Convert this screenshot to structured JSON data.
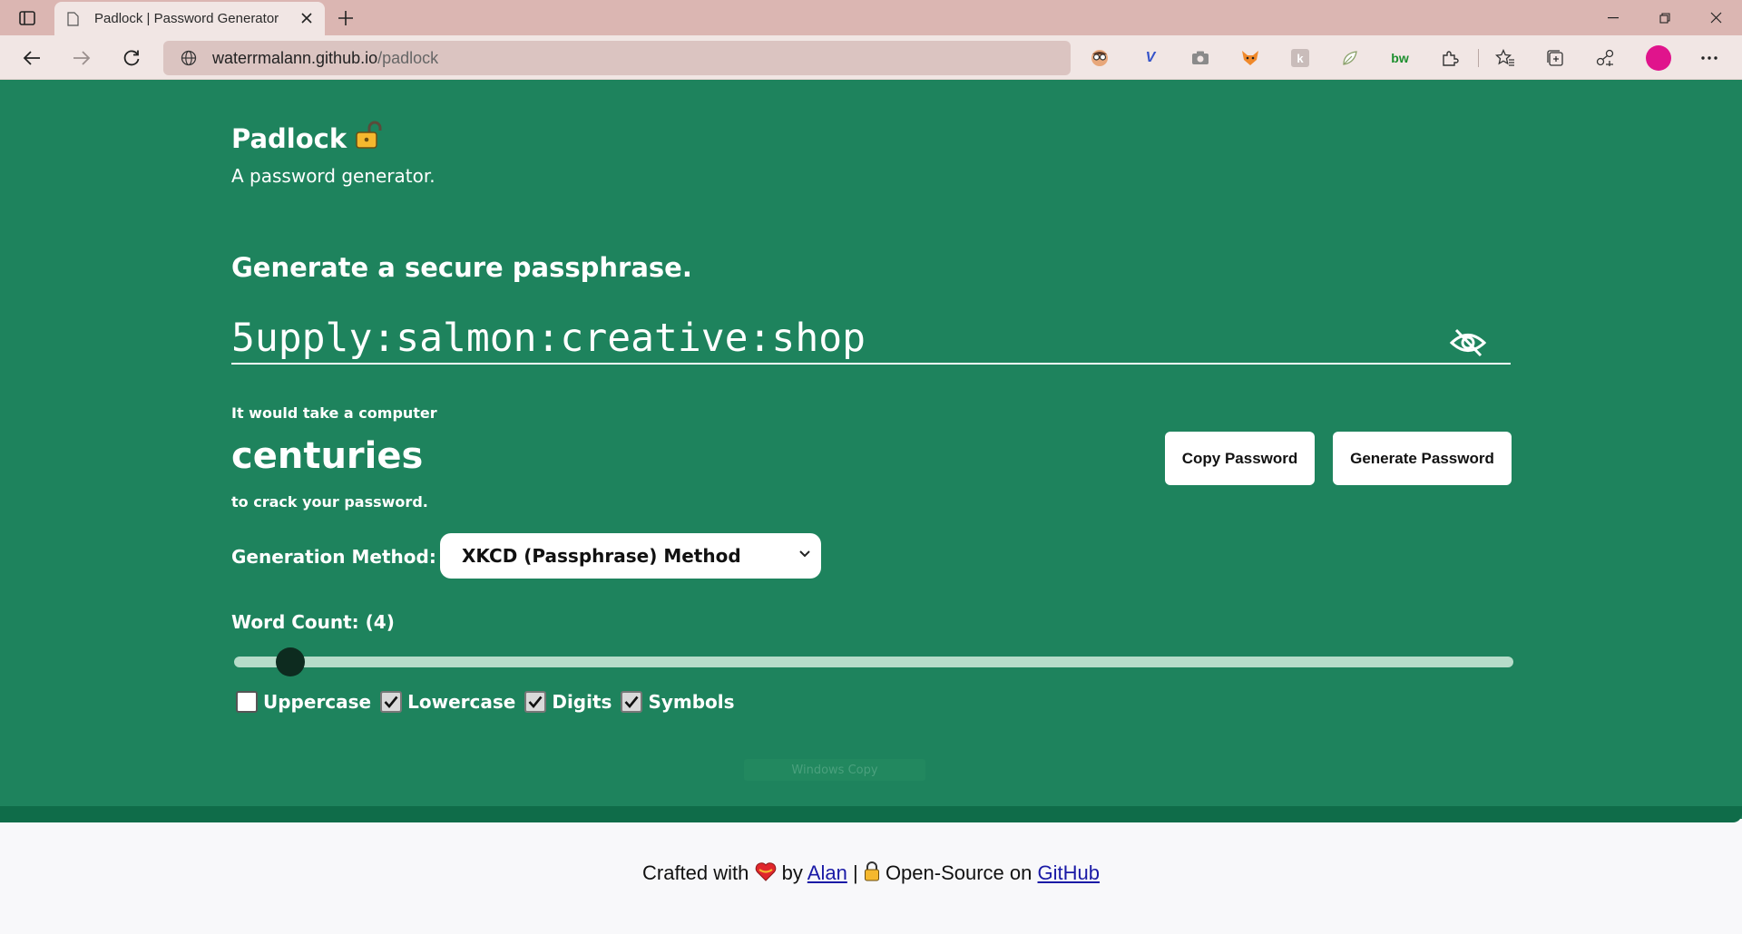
{
  "browser": {
    "tab": {
      "title": "Padlock | Password Generator"
    },
    "url": {
      "host": "waterrmalann.github.io",
      "path": "/padlock"
    },
    "extensions": [
      "face-extension",
      "v-extension",
      "camera-extension",
      "fox-extension",
      "k-extension",
      "leaf-extension",
      "bw-extension",
      "puzzle-extension"
    ],
    "ext_bw_label": "bw",
    "ext_v_label": "V",
    "ext_k_label": "k",
    "accent": "#e0148c"
  },
  "app": {
    "title": "Padlock",
    "subtitle": "A password generator.",
    "heading": "Generate a secure passphrase.",
    "password": "5upply:salmon:creative:shop",
    "crack": {
      "pre": "It would take a computer",
      "time": "centuries",
      "post": "to crack your password."
    },
    "buttons": {
      "copy": "Copy Password",
      "generate": "Generate Password"
    },
    "method": {
      "label": "Generation Method:",
      "selected": "XKCD (Passphrase) Method"
    },
    "word_count": {
      "label": "Word Count: (4)",
      "value": 4
    },
    "options": [
      {
        "label": "Uppercase",
        "checked": false
      },
      {
        "label": "Lowercase",
        "checked": true
      },
      {
        "label": "Digits",
        "checked": true
      },
      {
        "label": "Symbols",
        "checked": true
      }
    ],
    "faded_label": "Windows Copy",
    "colors": {
      "background": "#1e835d",
      "dark_band": "#0f6c49"
    }
  },
  "footer": {
    "crafted": "Crafted with",
    "by": "by",
    "author": "Alan",
    "sep": "|",
    "open_source": "Open-Source on",
    "repo": "GitHub"
  }
}
